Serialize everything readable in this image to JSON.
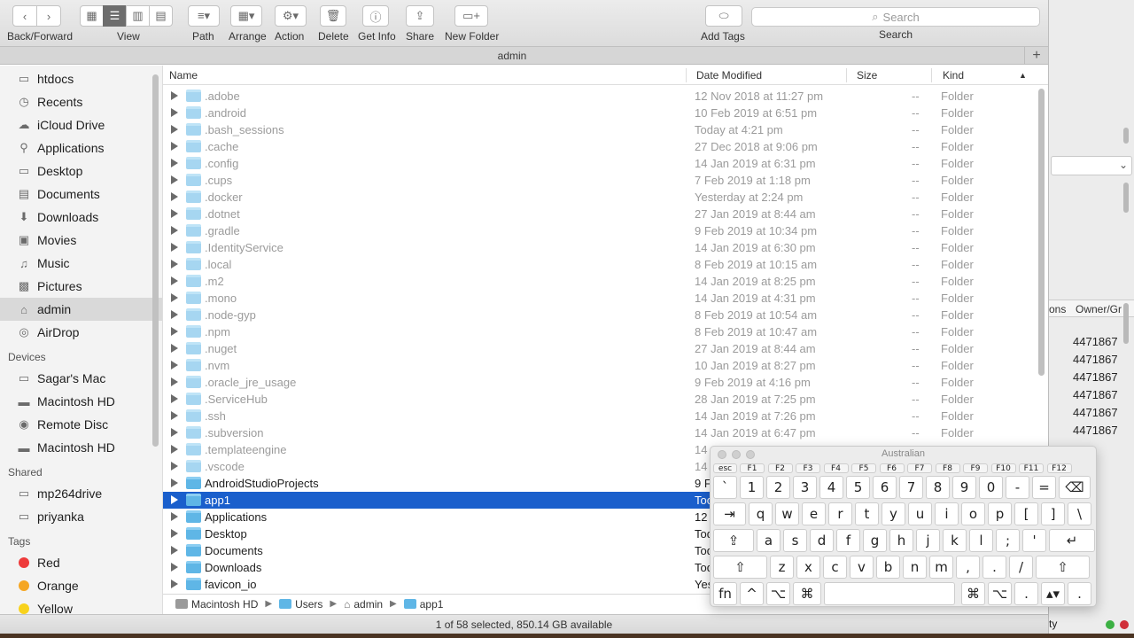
{
  "toolbar": {
    "back_forward_label": "Back/Forward",
    "view_label": "View",
    "path_label": "Path",
    "arrange_label": "Arrange",
    "action_label": "Action",
    "delete_label": "Delete",
    "get_info_label": "Get Info",
    "share_label": "Share",
    "new_folder_label": "New Folder",
    "add_tags_label": "Add Tags",
    "search_placeholder": "Search",
    "search_label": "Search"
  },
  "window_title": "admin",
  "sidebar": {
    "favorites": [
      "htdocs",
      "Recents",
      "iCloud Drive",
      "Applications",
      "Desktop",
      "Documents",
      "Downloads",
      "Movies",
      "Music",
      "Pictures",
      "admin",
      "AirDrop"
    ],
    "devices_header": "Devices",
    "devices": [
      "Sagar's Mac",
      "Macintosh HD",
      "Remote Disc",
      "Macintosh HD"
    ],
    "shared_header": "Shared",
    "shared": [
      "mp264drive",
      "priyanka"
    ],
    "tags_header": "Tags",
    "tags": [
      "Red",
      "Orange",
      "Yellow"
    ],
    "tag_colors": [
      "#ee3b3b",
      "#f5a623",
      "#f8d21c"
    ]
  },
  "columns": {
    "name": "Name",
    "date": "Date Modified",
    "size": "Size",
    "kind": "Kind"
  },
  "rows": [
    {
      "name": ".adobe",
      "date": "12 Nov 2018 at 11:27 pm",
      "size": "--",
      "kind": "Folder"
    },
    {
      "name": ".android",
      "date": "10 Feb 2019 at 6:51 pm",
      "size": "--",
      "kind": "Folder"
    },
    {
      "name": ".bash_sessions",
      "date": "Today at 4:21 pm",
      "size": "--",
      "kind": "Folder"
    },
    {
      "name": ".cache",
      "date": "27 Dec 2018 at 9:06 pm",
      "size": "--",
      "kind": "Folder"
    },
    {
      "name": ".config",
      "date": "14 Jan 2019 at 6:31 pm",
      "size": "--",
      "kind": "Folder"
    },
    {
      "name": ".cups",
      "date": "7 Feb 2019 at 1:18 pm",
      "size": "--",
      "kind": "Folder"
    },
    {
      "name": ".docker",
      "date": "Yesterday at 2:24 pm",
      "size": "--",
      "kind": "Folder"
    },
    {
      "name": ".dotnet",
      "date": "27 Jan 2019 at 8:44 am",
      "size": "--",
      "kind": "Folder"
    },
    {
      "name": ".gradle",
      "date": "9 Feb 2019 at 10:34 pm",
      "size": "--",
      "kind": "Folder"
    },
    {
      "name": ".IdentityService",
      "date": "14 Jan 2019 at 6:30 pm",
      "size": "--",
      "kind": "Folder"
    },
    {
      "name": ".local",
      "date": "8 Feb 2019 at 10:15 am",
      "size": "--",
      "kind": "Folder"
    },
    {
      "name": ".m2",
      "date": "14 Jan 2019 at 8:25 pm",
      "size": "--",
      "kind": "Folder"
    },
    {
      "name": ".mono",
      "date": "14 Jan 2019 at 4:31 pm",
      "size": "--",
      "kind": "Folder"
    },
    {
      "name": ".node-gyp",
      "date": "8 Feb 2019 at 10:54 am",
      "size": "--",
      "kind": "Folder"
    },
    {
      "name": ".npm",
      "date": "8 Feb 2019 at 10:47 am",
      "size": "--",
      "kind": "Folder"
    },
    {
      "name": ".nuget",
      "date": "27 Jan 2019 at 8:44 am",
      "size": "--",
      "kind": "Folder"
    },
    {
      "name": ".nvm",
      "date": "10 Jan 2019 at 8:27 pm",
      "size": "--",
      "kind": "Folder"
    },
    {
      "name": ".oracle_jre_usage",
      "date": "9 Feb 2019 at 4:16 pm",
      "size": "--",
      "kind": "Folder"
    },
    {
      "name": ".ServiceHub",
      "date": "28 Jan 2019 at 7:25 pm",
      "size": "--",
      "kind": "Folder"
    },
    {
      "name": ".ssh",
      "date": "14 Jan 2019 at 7:26 pm",
      "size": "--",
      "kind": "Folder"
    },
    {
      "name": ".subversion",
      "date": "14 Jan 2019 at 6:47 pm",
      "size": "--",
      "kind": "Folder"
    },
    {
      "name": ".templateengine",
      "date": "14",
      "size": "",
      "kind": ""
    },
    {
      "name": ".vscode",
      "date": "14",
      "size": "",
      "kind": ""
    },
    {
      "name": "AndroidStudioProjects",
      "date": "9 F",
      "size": "",
      "kind": ""
    },
    {
      "name": "app1",
      "date": "Too",
      "size": "",
      "kind": ""
    },
    {
      "name": "Applications",
      "date": "12 N",
      "size": "",
      "kind": ""
    },
    {
      "name": "Desktop",
      "date": "Tod",
      "size": "",
      "kind": ""
    },
    {
      "name": "Documents",
      "date": "Tod",
      "size": "",
      "kind": ""
    },
    {
      "name": "Downloads",
      "date": "Tod",
      "size": "",
      "kind": ""
    },
    {
      "name": "favicon_io",
      "date": "Yes",
      "size": "",
      "kind": ""
    }
  ],
  "selected_row": "app1",
  "breadcrumbs": [
    "Macintosh HD",
    "Users",
    "admin",
    "app1"
  ],
  "status_text": "1 of 58 selected, 850.14 GB available",
  "background_window": {
    "col_partial": "ons",
    "col_owner": "Owner/Gr",
    "values": [
      "4471867",
      "4471867",
      "4471867",
      "4471867",
      "4471867",
      "4471867"
    ],
    "bottom_partial": "ty"
  },
  "keyboard": {
    "title": "Australian",
    "fkeys": [
      "esc",
      "F1",
      "F2",
      "F3",
      "F4",
      "F5",
      "F6",
      "F7",
      "F8",
      "F9",
      "F10",
      "F11",
      "F12"
    ],
    "row1": [
      "`",
      "1",
      "2",
      "3",
      "4",
      "5",
      "6",
      "7",
      "8",
      "9",
      "0",
      "-",
      "=",
      "⌫"
    ],
    "row2": [
      "⇥",
      "q",
      "w",
      "e",
      "r",
      "t",
      "y",
      "u",
      "i",
      "o",
      "p",
      "[",
      "]",
      "\\"
    ],
    "row3": [
      "⇪",
      "a",
      "s",
      "d",
      "f",
      "g",
      "h",
      "j",
      "k",
      "l",
      ";",
      "'",
      "↵"
    ],
    "row4": [
      "⇧",
      "z",
      "x",
      "c",
      "v",
      "b",
      "n",
      "m",
      ",",
      ".",
      "/",
      "⇧"
    ],
    "row5": [
      "fn",
      "^",
      "⌥",
      "⌘",
      "",
      "⌘",
      "⌥",
      ".",
      "▴▾",
      "."
    ]
  }
}
